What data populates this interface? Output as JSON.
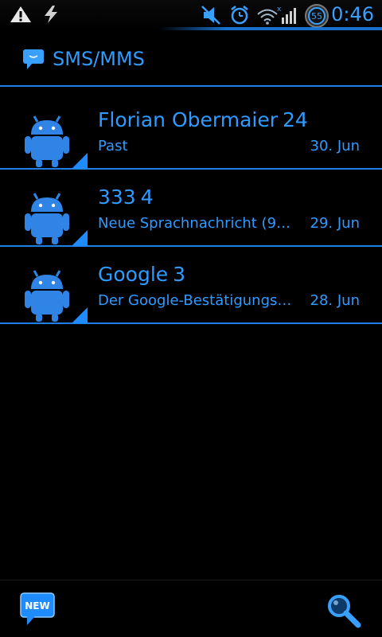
{
  "status_bar": {
    "time": "0:46",
    "battery_level": "55",
    "icons": [
      "warning-icon",
      "charging-bolt-icon",
      "no-sound-icon",
      "alarm-icon",
      "wifi-signal-icon",
      "battery-icon"
    ]
  },
  "app": {
    "title": "SMS/MMS"
  },
  "conversations": [
    {
      "name": "Florian Obermaier",
      "count": "24",
      "snippet": "Past",
      "date": "30. Jun"
    },
    {
      "name": "333",
      "count": "4",
      "snippet": "Neue Sprachnachricht (9…",
      "date": "29. Jun"
    },
    {
      "name": "Google",
      "count": "3",
      "snippet": "Der Google-Bestätigungs…",
      "date": "28. Jun"
    }
  ],
  "bottom_bar": {
    "new_label": "NEW"
  },
  "colors": {
    "accent": "#2f9bff",
    "divider": "#1e7fe6",
    "background": "#000000"
  }
}
